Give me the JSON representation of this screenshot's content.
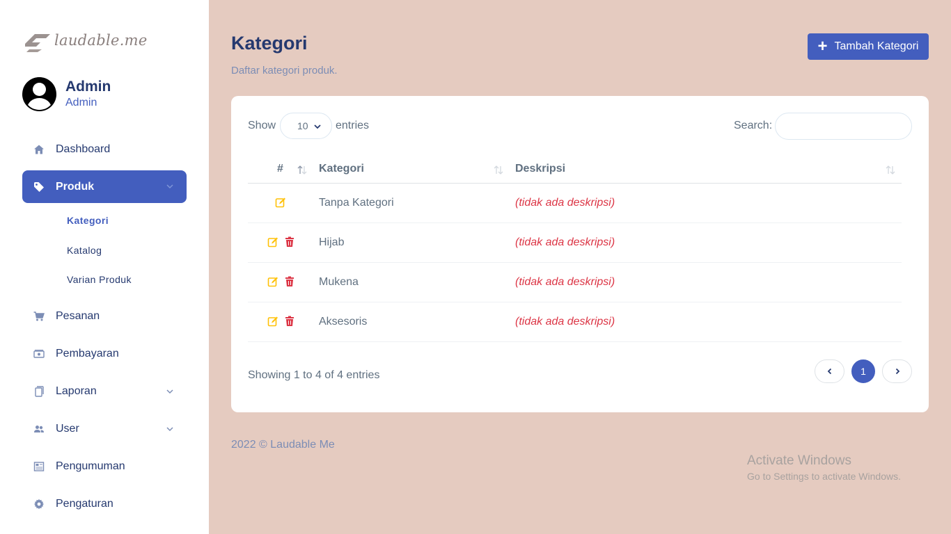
{
  "brand": {
    "logo_text": "laudable.me"
  },
  "profile": {
    "name": "Admin",
    "role": "Admin"
  },
  "sidebar": {
    "items": [
      {
        "label": "Dashboard",
        "icon": "home-icon"
      },
      {
        "label": "Produk",
        "icon": "tag-icon",
        "active": true,
        "expandable": true,
        "children": [
          {
            "label": "Kategori",
            "active": true
          },
          {
            "label": "Katalog"
          },
          {
            "label": "Varian Produk"
          }
        ]
      },
      {
        "label": "Pesanan",
        "icon": "cart-icon"
      },
      {
        "label": "Pembayaran",
        "icon": "cash-icon"
      },
      {
        "label": "Laporan",
        "icon": "document-icon",
        "expandable": true
      },
      {
        "label": "User",
        "icon": "people-icon",
        "expandable": true
      },
      {
        "label": "Pengumuman",
        "icon": "newspaper-icon"
      },
      {
        "label": "Pengaturan",
        "icon": "gear-icon"
      }
    ]
  },
  "page": {
    "title": "Kategori",
    "subtitle": "Daftar kategori produk.",
    "add_button": "Tambah Kategori"
  },
  "table_controls": {
    "show_label": "Show",
    "entries_value": "10",
    "entries_label": "entries",
    "search_label": "Search:",
    "search_value": ""
  },
  "table": {
    "columns": [
      "#",
      "Kategori",
      "Deskripsi"
    ],
    "rows": [
      {
        "name": "Tanpa Kategori",
        "description": "(tidak ada deskripsi)",
        "can_delete": false
      },
      {
        "name": "Hijab",
        "description": "(tidak ada deskripsi)",
        "can_delete": true
      },
      {
        "name": "Mukena",
        "description": "(tidak ada deskripsi)",
        "can_delete": true
      },
      {
        "name": "Aksesoris",
        "description": "(tidak ada deskripsi)",
        "can_delete": true
      }
    ]
  },
  "pagination": {
    "info": "Showing 1 to 4 of 4 entries",
    "prev": "‹",
    "current": "1",
    "next": "›"
  },
  "footer": {
    "text": "2022 © Laudable Me"
  },
  "watermark": {
    "line1": "Activate Windows",
    "line2": "Go to Settings to activate Windows."
  },
  "colors": {
    "primary": "#435ebe",
    "background": "#e5cbc0",
    "edit": "#ffc107",
    "delete": "#dc3545",
    "text": "#25396f"
  }
}
